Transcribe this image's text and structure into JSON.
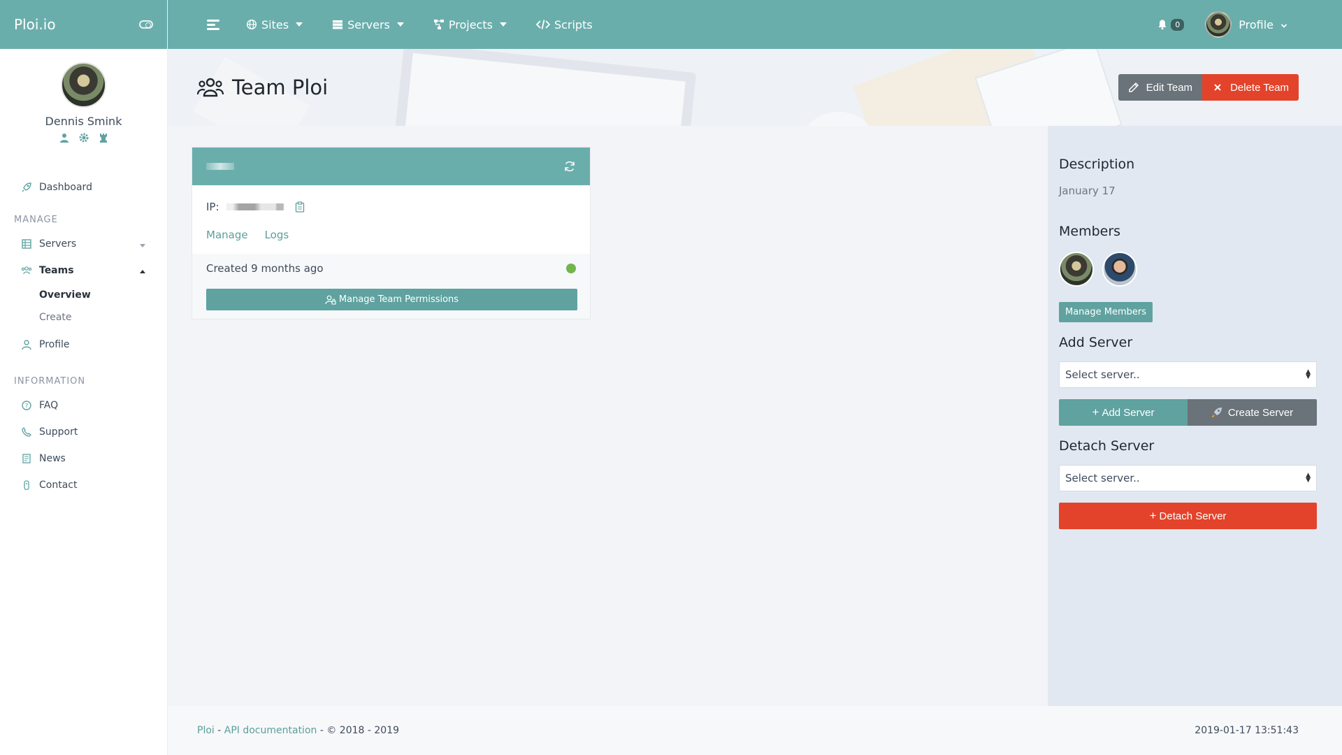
{
  "brand": {
    "name": "Ploi.io"
  },
  "user": {
    "name": "Dennis Smink"
  },
  "sidebar": {
    "dashboard": "Dashboard",
    "manage_heading": "MANAGE",
    "servers": "Servers",
    "teams": "Teams",
    "teams_sub": [
      "Overview",
      "Create"
    ],
    "profile": "Profile",
    "info_heading": "INFORMATION",
    "faq": "FAQ",
    "support": "Support",
    "news": "News",
    "contact": "Contact"
  },
  "topbar": {
    "sites": "Sites",
    "servers": "Servers",
    "projects": "Projects",
    "scripts": "Scripts",
    "notification_count": "0",
    "profile": "Profile"
  },
  "header": {
    "title": "Team Ploi",
    "edit_button": "Edit Team",
    "delete_button": "Delete Team"
  },
  "server_card": {
    "ip_label": "IP:",
    "manage_link": "Manage",
    "logs_link": "Logs",
    "created": "Created 9 months ago",
    "permissions_button": "Manage Team Permissions"
  },
  "panel": {
    "description_heading": "Description",
    "description": "January 17",
    "members_heading": "Members",
    "manage_members_button": "Manage Members",
    "add_server_heading": "Add Server",
    "add_select_placeholder": "Select server..",
    "add_server_button": "Add Server",
    "create_server_button": "Create Server",
    "detach_server_heading": "Detach Server",
    "detach_select_placeholder": "Select server..",
    "detach_server_button": "Detach Server"
  },
  "footer": {
    "brand_link": "Ploi",
    "separator1": " - ",
    "api_link": "API documentation",
    "copyright": " - © 2018 - 2019",
    "timestamp": "2019-01-17 13:51:43"
  },
  "colors": {
    "brand": "#6aaeac",
    "accent_button": "#5fa2a0",
    "danger": "#e3432a",
    "secondary": "#6a7379",
    "status_online": "#71b54b"
  }
}
